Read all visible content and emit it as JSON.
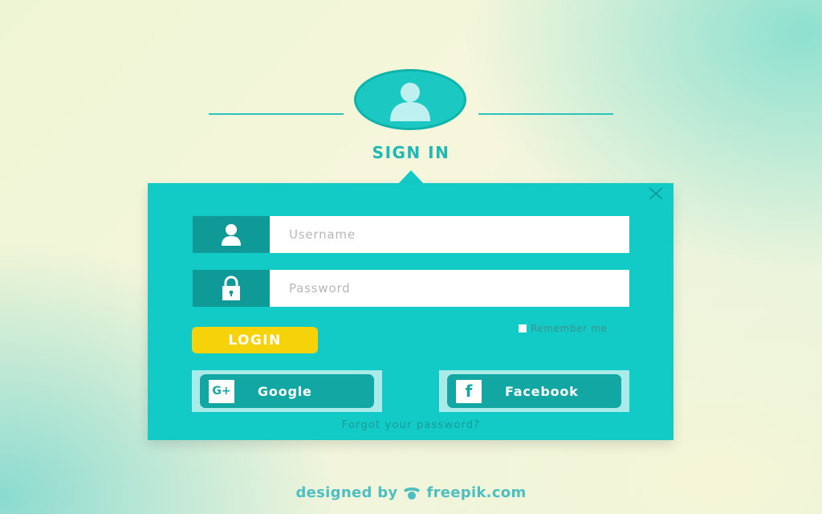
{
  "colors": {
    "accent": "#12cbc7",
    "accent_dark": "#0f9a98",
    "title": "#1fb9b3",
    "line": "#2cc4bd",
    "login_button": "#f6d20a",
    "remember_text": "#3f8f8c",
    "forgot_text": "#1b9a97",
    "social_frame": "#a8ebe9",
    "social_button": "#13a7a4",
    "watermark": "#4dbfc1"
  },
  "header": {
    "title": "SIGN IN",
    "avatar_icon": "user-silhouette-icon"
  },
  "form": {
    "close_icon": "close-icon",
    "username": {
      "icon": "user-icon",
      "placeholder": "Username",
      "value": ""
    },
    "password": {
      "icon": "lock-icon",
      "placeholder": "Password",
      "value": ""
    },
    "remember_label": "Remember me",
    "remember_checked": false,
    "login_label": "LOGIN",
    "social": [
      {
        "label": "Google",
        "icon": "google-plus-icon",
        "icon_text": "G+"
      },
      {
        "label": "Facebook",
        "icon": "facebook-icon",
        "icon_text": "f"
      }
    ],
    "forgot_label": "Forgot your password?"
  },
  "watermark": {
    "prefix": "designed by",
    "brand": "freepik.com",
    "icon": "freepik-logo-icon"
  }
}
